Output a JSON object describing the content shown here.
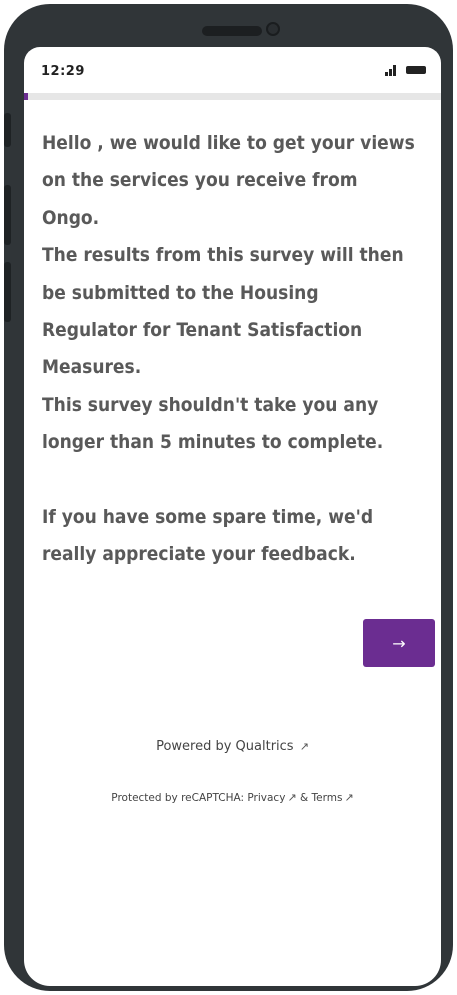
{
  "status_bar": {
    "time": "12:29",
    "signal_icon": "signal-icon",
    "battery_icon": "battery-icon"
  },
  "progress": {
    "fraction": 0.01
  },
  "question": {
    "lines": [
      "Hello , we would like to get your views",
      "on the services you receive from",
      "Ongo.",
      "The results from this survey will then",
      "be submitted to the Housing",
      "Regulator for Tenant Satisfaction",
      "Measures.",
      "This survey shouldn't take you any",
      "longer than 5 minutes to complete.",
      "",
      "If you have some spare time, we'd",
      "really appreciate your feedback."
    ]
  },
  "next_button": {
    "glyph": "→",
    "icon": "arrow-right-icon"
  },
  "footer": {
    "powered_text": "Powered by Qualtrics",
    "recaptcha_prefix": "Protected by reCAPTCHA:",
    "privacy_label": "Privacy",
    "amp": "&",
    "terms_label": "Terms",
    "external_link_glyph": "↗",
    "external_link_icon": "external-link-icon"
  },
  "colors": {
    "accent": "#6b2d91",
    "text": "#595959",
    "phone_frame": "#303538"
  }
}
